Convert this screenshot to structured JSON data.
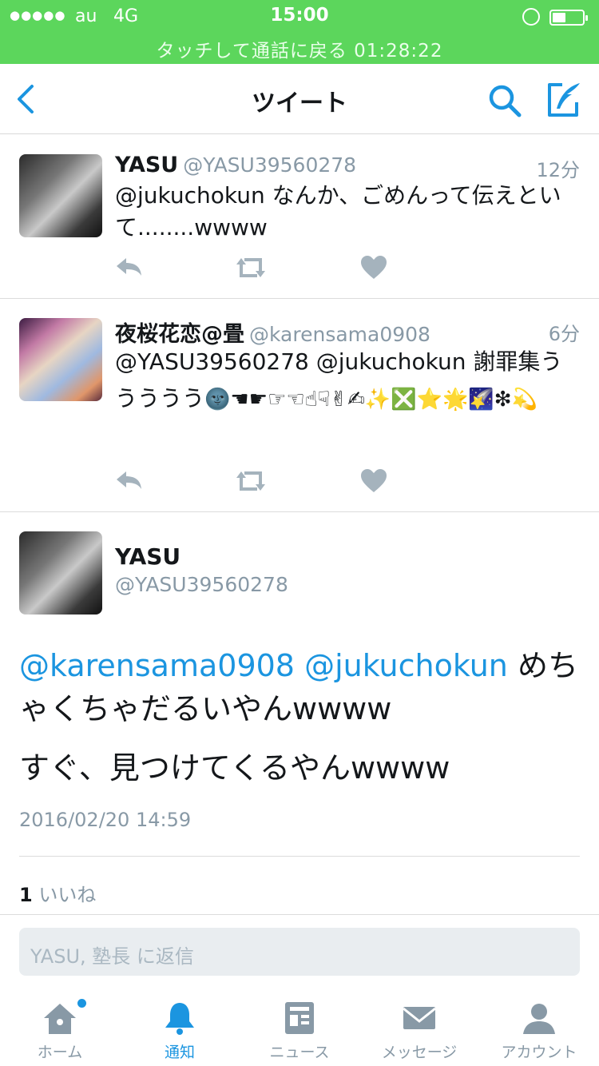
{
  "status_bar": {
    "signal": "●●●●●",
    "carrier": "au",
    "network": "4G",
    "time": "15:00",
    "call_banner": "タッチして通話に戻る  01:28:22"
  },
  "nav": {
    "title": "ツイート"
  },
  "timeline": [
    {
      "name": "YASU",
      "handle": "@YASU39560278",
      "time": "12分",
      "text": "@jukuchokun なんか、ごめんって伝えといて........wwww"
    },
    {
      "name": "夜桜花恋@畳",
      "handle": "@karensama0908",
      "time": "6分",
      "text": "@YASU39560278 @jukuchokun 謝罪集ううううう",
      "emoji": "🌚☚☛☞☜☝☟✌✍✨❎⭐🌟🌠❇💫"
    }
  ],
  "detail": {
    "name": "YASU",
    "handle": "@YASU39560278",
    "mention1": "@karensama0908",
    "mention2": "@jukuchokun",
    "text1": " めちゃくちゃだるいやんwwww",
    "text2": "すぐ、見つけてくるやんwwww",
    "date": "2016/02/20 14:59",
    "likes_count": "1",
    "likes_label": "いいね"
  },
  "reply": {
    "placeholder": "YASU, 塾長 に返信"
  },
  "tabs": [
    {
      "label": "ホーム",
      "icon": "home-icon"
    },
    {
      "label": "通知",
      "icon": "bell-icon"
    },
    {
      "label": "ニュース",
      "icon": "news-icon"
    },
    {
      "label": "メッセージ",
      "icon": "envelope-icon"
    },
    {
      "label": "アカウント",
      "icon": "person-icon"
    }
  ],
  "colors": {
    "status_bar": "#5cd65c",
    "accent": "#1b95e0",
    "muted": "#8899a6"
  }
}
